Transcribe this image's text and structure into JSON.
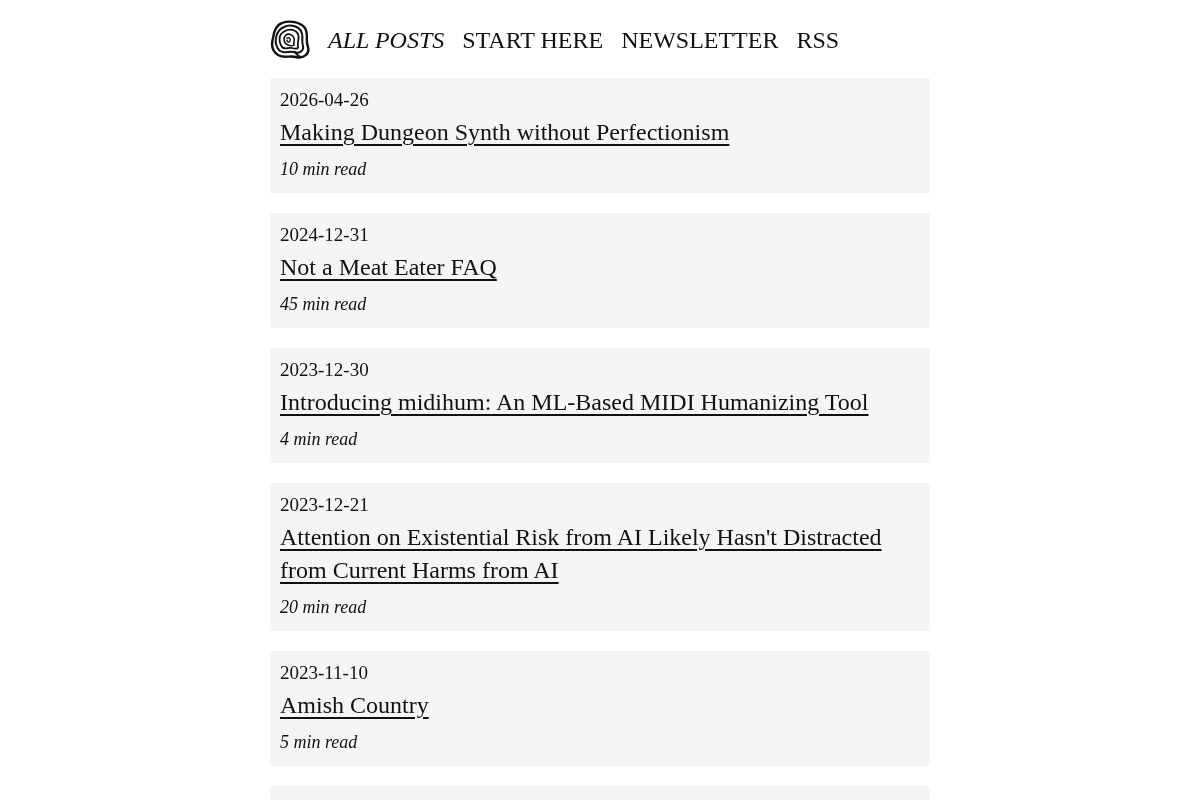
{
  "nav": [
    {
      "label": "ALL POSTS",
      "selected": true
    },
    {
      "label": "START HERE",
      "selected": false
    },
    {
      "label": "NEWSLETTER",
      "selected": false
    },
    {
      "label": "RSS",
      "selected": false
    }
  ],
  "posts": [
    {
      "date": "2026-04-26",
      "title": "Making Dungeon Synth without Perfectionism",
      "read_time": "10 min read"
    },
    {
      "date": "2024-12-31",
      "title": "Not a Meat Eater FAQ",
      "read_time": "45 min read"
    },
    {
      "date": "2023-12-30",
      "title": "Introducing midihum: An ML-Based MIDI Humanizing Tool",
      "read_time": "4 min read"
    },
    {
      "date": "2023-12-21",
      "title": "Attention on Existential Risk from AI Likely Hasn't Distracted from Current Harms from AI",
      "read_time": "20 min read"
    },
    {
      "date": "2023-11-10",
      "title": "Amish Country",
      "read_time": "5 min read"
    }
  ]
}
